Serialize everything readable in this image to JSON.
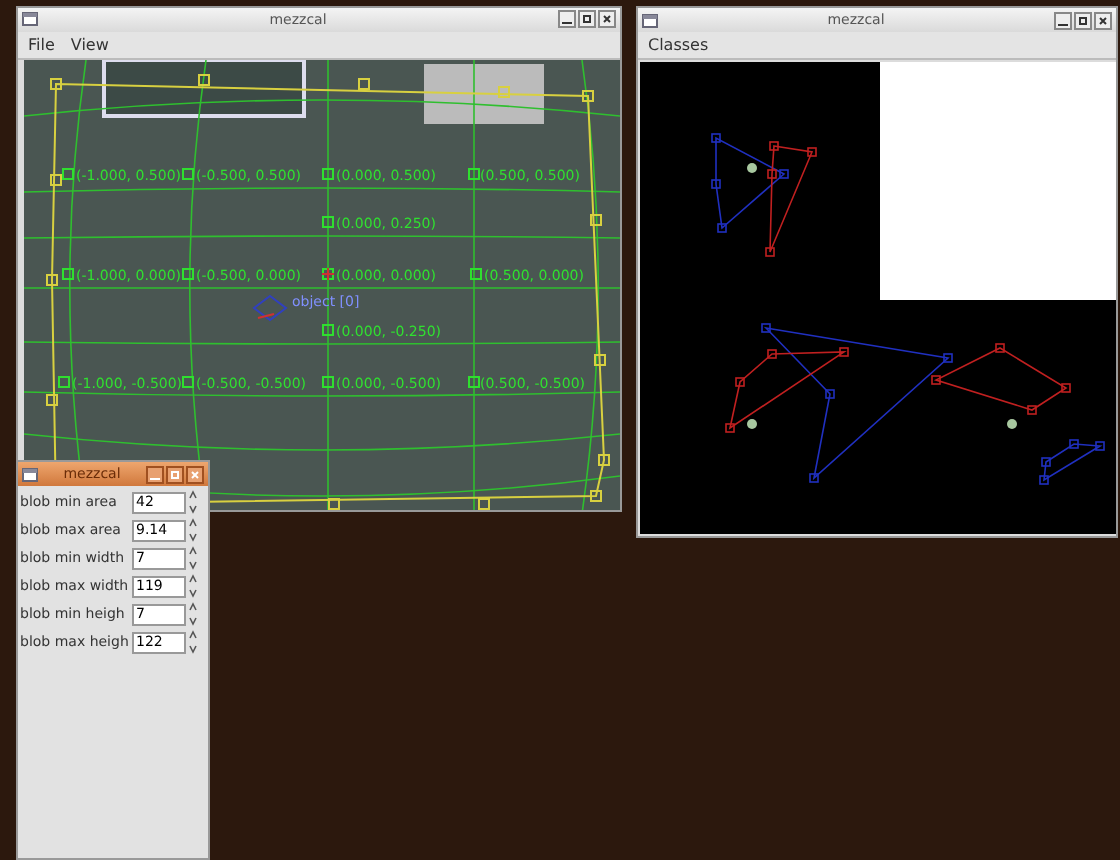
{
  "calibration_window": {
    "title": "mezzcal",
    "menu": [
      "File",
      "View"
    ],
    "grid_labels": [
      "(-1.000, 0.500)",
      "(-0.500, 0.500)",
      "(0.000, 0.500)",
      "(0.500, 0.500)",
      "(0.000, 0.250)",
      "(-1.000, 0.000)",
      "(-0.500, 0.000)",
      "(0.000, 0.000)",
      "(0.500, 0.000)",
      "(0.000, -0.250)",
      "(-1.000, -0.500)",
      "(-0.500, -0.500)",
      "(0.000, -0.500)",
      "(0.500, -0.500)"
    ],
    "object_label": "object [0]"
  },
  "classes_window": {
    "title": "mezzcal",
    "menu": [
      "Classes"
    ]
  },
  "settings_window": {
    "title": "mezzcal",
    "fields": [
      {
        "label": "blob min area",
        "value": "42"
      },
      {
        "label": "blob max area",
        "value": "9.14"
      },
      {
        "label": "blob min width",
        "value": "7"
      },
      {
        "label": "blob max width",
        "value": "119"
      },
      {
        "label": "blob min heigh",
        "value": "7"
      },
      {
        "label": "blob max heigh",
        "value": "122"
      }
    ]
  }
}
